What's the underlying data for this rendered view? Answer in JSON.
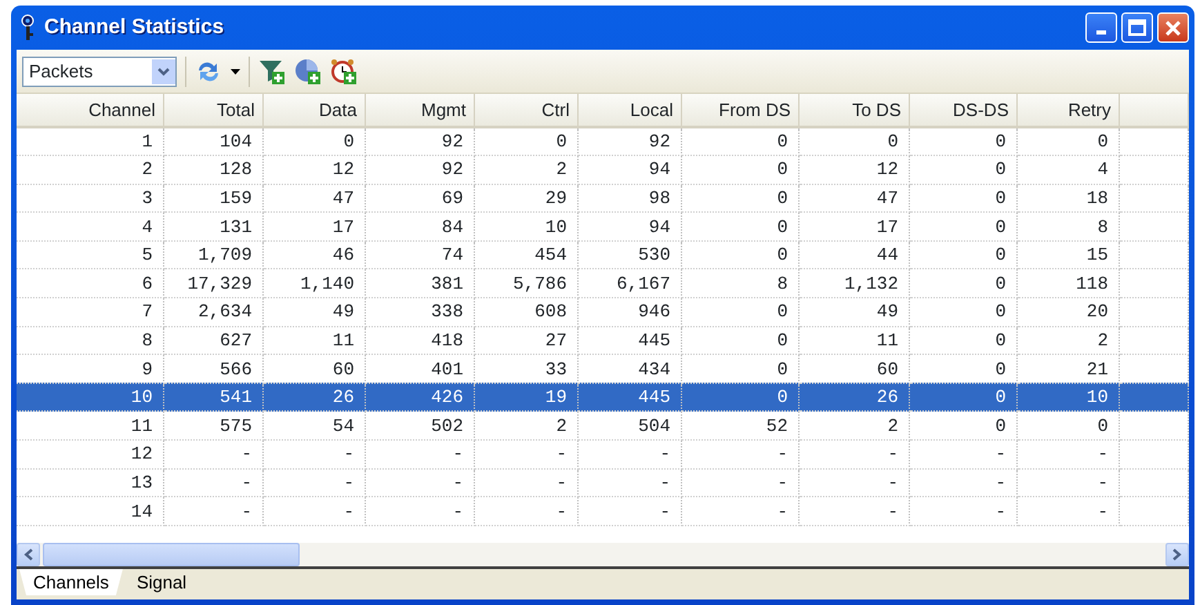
{
  "window": {
    "title": "Channel Statistics"
  },
  "toolbar": {
    "view_select": {
      "value": "Packets"
    }
  },
  "table": {
    "columns": [
      "Channel",
      "Total",
      "Data",
      "Mgmt",
      "Ctrl",
      "Local",
      "From DS",
      "To DS",
      "DS-DS",
      "Retry"
    ],
    "rows": [
      {
        "cells": [
          "1",
          "104",
          "0",
          "92",
          "0",
          "92",
          "0",
          "0",
          "0",
          "0"
        ],
        "selected": false
      },
      {
        "cells": [
          "2",
          "128",
          "12",
          "92",
          "2",
          "94",
          "0",
          "12",
          "0",
          "4"
        ],
        "selected": false
      },
      {
        "cells": [
          "3",
          "159",
          "47",
          "69",
          "29",
          "98",
          "0",
          "47",
          "0",
          "18"
        ],
        "selected": false
      },
      {
        "cells": [
          "4",
          "131",
          "17",
          "84",
          "10",
          "94",
          "0",
          "17",
          "0",
          "8"
        ],
        "selected": false
      },
      {
        "cells": [
          "5",
          "1,709",
          "46",
          "74",
          "454",
          "530",
          "0",
          "44",
          "0",
          "15"
        ],
        "selected": false
      },
      {
        "cells": [
          "6",
          "17,329",
          "1,140",
          "381",
          "5,786",
          "6,167",
          "8",
          "1,132",
          "0",
          "118"
        ],
        "selected": false
      },
      {
        "cells": [
          "7",
          "2,634",
          "49",
          "338",
          "608",
          "946",
          "0",
          "49",
          "0",
          "20"
        ],
        "selected": false
      },
      {
        "cells": [
          "8",
          "627",
          "11",
          "418",
          "27",
          "445",
          "0",
          "11",
          "0",
          "2"
        ],
        "selected": false
      },
      {
        "cells": [
          "9",
          "566",
          "60",
          "401",
          "33",
          "434",
          "0",
          "60",
          "0",
          "21"
        ],
        "selected": false
      },
      {
        "cells": [
          "10",
          "541",
          "26",
          "426",
          "19",
          "445",
          "0",
          "26",
          "0",
          "10"
        ],
        "selected": true
      },
      {
        "cells": [
          "11",
          "575",
          "54",
          "502",
          "2",
          "504",
          "52",
          "2",
          "0",
          "0"
        ],
        "selected": false
      },
      {
        "cells": [
          "12",
          "-",
          "-",
          "-",
          "-",
          "-",
          "-",
          "-",
          "-",
          "-"
        ],
        "selected": false
      },
      {
        "cells": [
          "13",
          "-",
          "-",
          "-",
          "-",
          "-",
          "-",
          "-",
          "-",
          "-"
        ],
        "selected": false
      },
      {
        "cells": [
          "14",
          "-",
          "-",
          "-",
          "-",
          "-",
          "-",
          "-",
          "-",
          "-"
        ],
        "selected": false
      }
    ]
  },
  "tabs": [
    {
      "label": "Channels",
      "selected": true
    },
    {
      "label": "Signal",
      "selected": false
    }
  ]
}
